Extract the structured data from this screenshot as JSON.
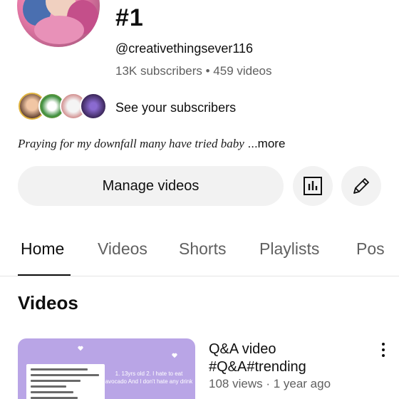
{
  "channel": {
    "title": "#1",
    "handle": "@creativethingsever116",
    "stats": "13K subscribers • 459 videos",
    "see_subscribers_label": "See your subscribers",
    "description": "Praying for my downfall many have tried baby",
    "more_label": "...more"
  },
  "actions": {
    "manage_videos_label": "Manage videos",
    "analytics_icon": "bar-chart-icon",
    "edit_icon": "pencil-icon"
  },
  "tabs": [
    {
      "label": "Home",
      "active": true
    },
    {
      "label": "Videos",
      "active": false
    },
    {
      "label": "Shorts",
      "active": false
    },
    {
      "label": "Playlists",
      "active": false
    },
    {
      "label": "Pos",
      "active": false
    }
  ],
  "section": {
    "title": "Videos"
  },
  "videos": [
    {
      "title": "Q&A video #Q&A#trending",
      "meta": "108 views · 1 year ago",
      "thumbnail_text": "1. 13yrs old 2. I hate to eat avocado And I don't hate any drink"
    }
  ],
  "colors": {
    "text_primary": "#0f0f0f",
    "text_secondary": "#606060",
    "button_bg": "#f2f2f2",
    "thumbnail_bg": "#b9a5e6"
  }
}
